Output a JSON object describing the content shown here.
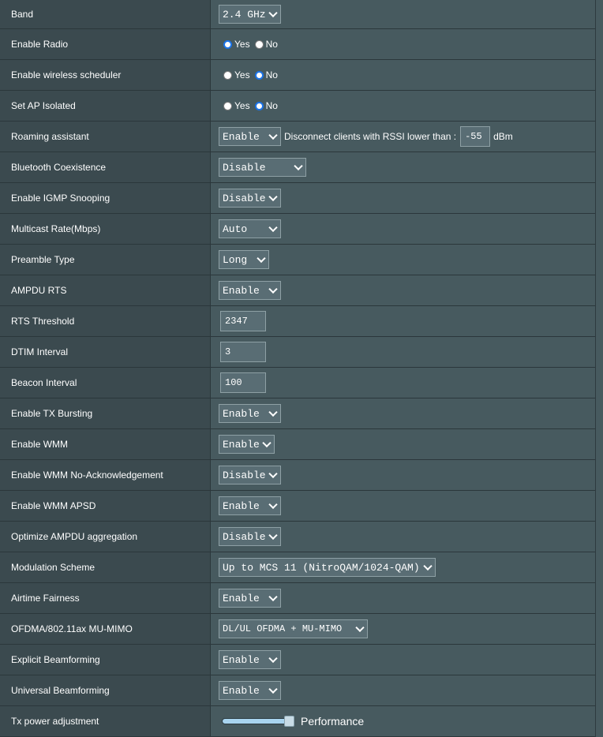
{
  "rows": [
    {
      "label": "Band",
      "select": "2.4 GHz"
    },
    {
      "label": "Enable Radio",
      "radio": {
        "yes": "Yes",
        "no": "No",
        "selected": "yes"
      }
    },
    {
      "label": "Enable wireless scheduler",
      "radio": {
        "yes": "Yes",
        "no": "No",
        "selected": "no"
      }
    },
    {
      "label": "Set AP Isolated",
      "radio": {
        "yes": "Yes",
        "no": "No",
        "selected": "no"
      }
    },
    {
      "label": "Roaming assistant",
      "select": "Enable",
      "text": "Disconnect clients with RSSI lower than :",
      "input": "-55",
      "unit": "dBm"
    },
    {
      "label": "Bluetooth Coexistence",
      "select": "Disable"
    },
    {
      "label": "Enable IGMP Snooping",
      "select": "Disable"
    },
    {
      "label": "Multicast Rate(Mbps)",
      "select": "Auto"
    },
    {
      "label": "Preamble Type",
      "select": "Long"
    },
    {
      "label": "AMPDU RTS",
      "select": "Enable"
    },
    {
      "label": "RTS Threshold",
      "input": "2347"
    },
    {
      "label": "DTIM Interval",
      "input": "3"
    },
    {
      "label": "Beacon Interval",
      "input": "100"
    },
    {
      "label": "Enable TX Bursting",
      "select": "Enable"
    },
    {
      "label": "Enable WMM",
      "select": "Enable"
    },
    {
      "label": "Enable WMM No-Acknowledgement",
      "select": "Disable"
    },
    {
      "label": "Enable WMM APSD",
      "select": "Enable"
    },
    {
      "label": "Optimize AMPDU aggregation",
      "select": "Disable"
    },
    {
      "label": "Modulation Scheme",
      "select": "Up to MCS 11 (NitroQAM/1024-QAM)"
    },
    {
      "label": "Airtime Fairness",
      "select": "Enable"
    },
    {
      "label": "OFDMA/802.11ax MU-MIMO",
      "select": "DL/UL OFDMA + MU-MIMO"
    },
    {
      "label": "Explicit Beamforming",
      "select": "Enable"
    },
    {
      "label": "Universal Beamforming",
      "select": "Enable"
    },
    {
      "label": "Tx power adjustment",
      "slider": {
        "label": "Performance",
        "level": 1.0
      }
    }
  ]
}
